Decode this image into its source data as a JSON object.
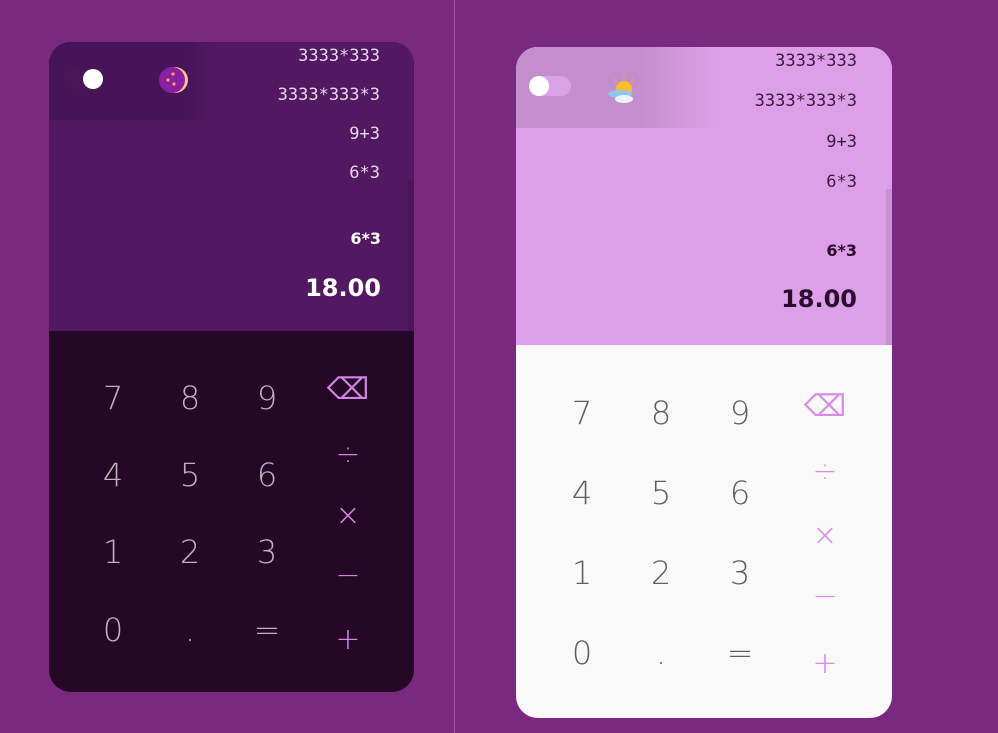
{
  "colors": {
    "background": "#79297f",
    "accent": "#d88be8"
  },
  "calculators": [
    {
      "theme": "dark",
      "mode_icon": "moon-icon",
      "history": [
        "3333*333",
        "3333*333*3",
        "9+3",
        "6*3"
      ],
      "expression": "6*3",
      "result": "18.00",
      "digits": [
        "7",
        "8",
        "9",
        "4",
        "5",
        "6",
        "1",
        "2",
        "3",
        "0",
        ".",
        "="
      ],
      "operators": [
        "⌫",
        "÷",
        "×",
        "−",
        "+"
      ]
    },
    {
      "theme": "light",
      "mode_icon": "sun-cloud-icon",
      "history": [
        "3333*333",
        "3333*333*3",
        "9+3",
        "6*3"
      ],
      "expression": "6*3",
      "result": "18.00",
      "digits": [
        "7",
        "8",
        "9",
        "4",
        "5",
        "6",
        "1",
        "2",
        "3",
        "0",
        ".",
        "="
      ],
      "operators": [
        "⌫",
        "÷",
        "×",
        "−",
        "+"
      ]
    }
  ]
}
